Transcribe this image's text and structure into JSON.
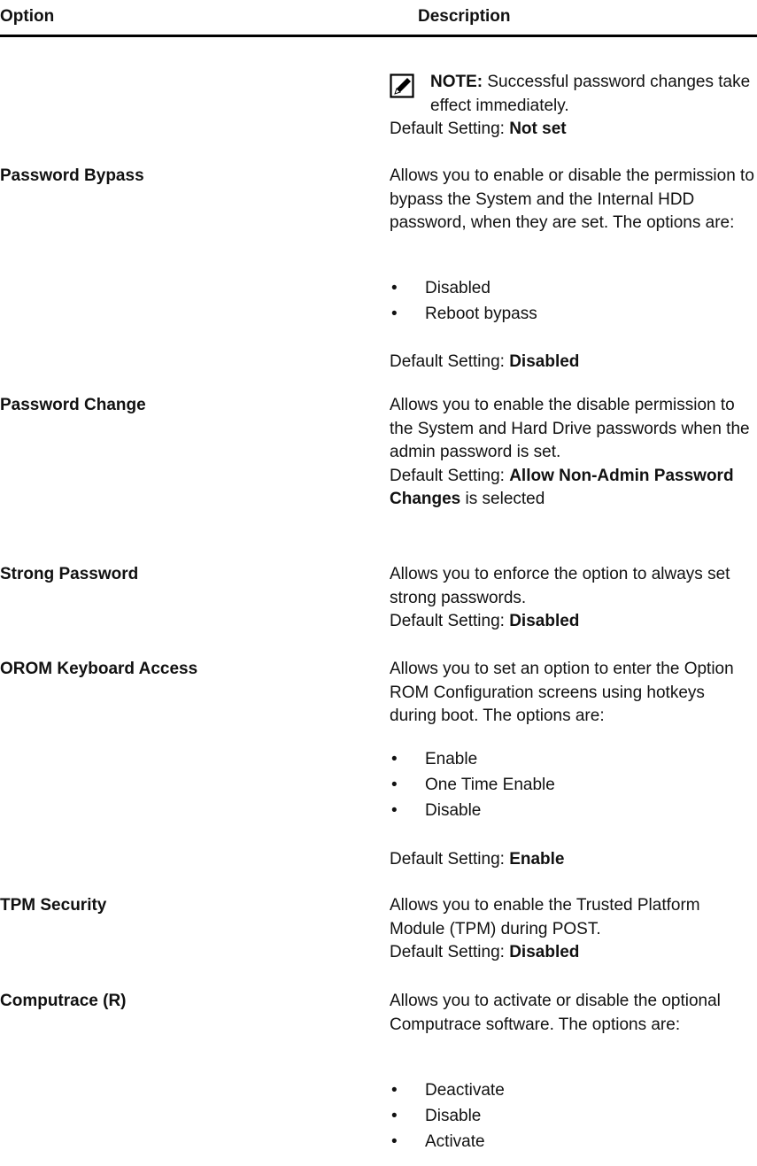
{
  "header": {
    "option": "Option",
    "description": "Description"
  },
  "note": {
    "label": "NOTE:",
    "text": " Successful password changes take effect immediately.",
    "icon": "note-pencil-icon"
  },
  "first_default": {
    "prefix": "Default Setting: ",
    "value": "Not set"
  },
  "rows": [
    {
      "option": "Password Bypass",
      "description": "Allows you to enable or disable the permission to bypass the System and the Internal HDD password, when they are set. The options are:",
      "items": [
        "Disabled",
        "Reboot bypass"
      ],
      "default_prefix": "Default Setting: ",
      "default_value": "Disabled"
    },
    {
      "option": "Password Change",
      "description": "Allows you to enable the disable permission to the System and Hard Drive passwords when the admin password is set.",
      "default_prefix": "Default Setting: ",
      "default_value": "Allow Non-Admin Password Changes",
      "default_suffix": " is selected"
    },
    {
      "option": "Strong Password",
      "description": "Allows you to enforce the option to always set strong passwords.",
      "default_prefix": "Default Setting: ",
      "default_value": "Disabled"
    },
    {
      "option": "OROM Keyboard Access",
      "description": "Allows you to set an option to enter the Option ROM Configuration screens using hotkeys during boot. The options are:",
      "items": [
        "Enable",
        "One Time Enable",
        "Disable"
      ],
      "default_prefix": "Default Setting: ",
      "default_value": "Enable"
    },
    {
      "option": "TPM Security",
      "description": "Allows you to enable the Trusted Platform Module (TPM) during POST.",
      "default_prefix": "Default Setting: ",
      "default_value": "Disabled"
    },
    {
      "option": "Computrace (R)",
      "description": "Allows you to activate or disable the optional Computrace software. The options are:",
      "items": [
        "Deactivate",
        "Disable",
        "Activate"
      ]
    }
  ]
}
